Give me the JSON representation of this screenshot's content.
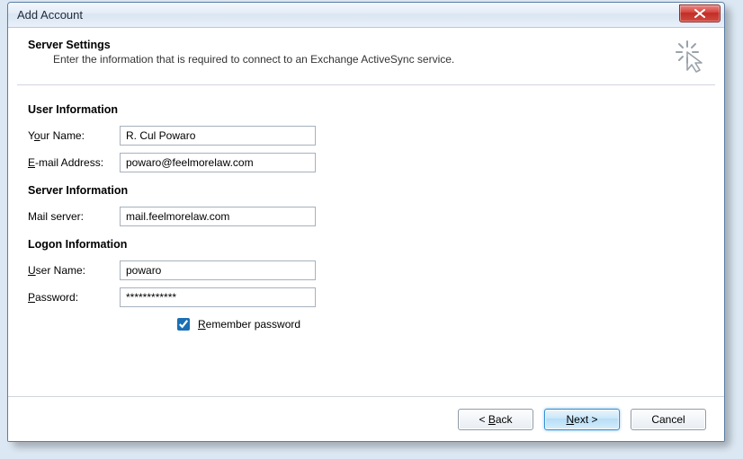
{
  "window": {
    "title": "Add Account"
  },
  "header": {
    "title": "Server Settings",
    "subtitle": "Enter the information that is required to connect to an Exchange ActiveSync service."
  },
  "sections": {
    "user_info": "User Information",
    "server_info": "Server Information",
    "logon_info": "Logon Information"
  },
  "labels": {
    "your_name_pre": "Y",
    "your_name_u": "o",
    "your_name_post": "ur Name:",
    "email_u": "E",
    "email_post": "-mail Address:",
    "mail_server": "Mail server:",
    "user_name_u": "U",
    "user_name_post": "ser Name:",
    "password_u": "P",
    "password_post": "assword:",
    "remember_u": "R",
    "remember_post": "emember password"
  },
  "fields": {
    "your_name": "R. Cul Powaro",
    "email": "powaro@feelmorelaw.com",
    "mail_server": "mail.feelmorelaw.com",
    "user_name": "powaro",
    "password": "************"
  },
  "remember_checked": true,
  "buttons": {
    "back_pre": "< ",
    "back_u": "B",
    "back_post": "ack",
    "next_u": "N",
    "next_post": "ext >",
    "cancel": "Cancel"
  }
}
